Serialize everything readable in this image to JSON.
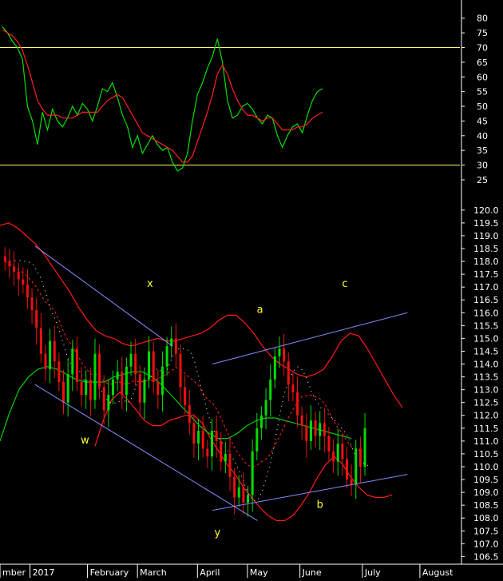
{
  "colors": {
    "background": "#000000",
    "axis": "#ffffff",
    "axis_text": "#ffffff",
    "oscillator": "#00e000",
    "signal": "#ff2020",
    "reference_line": "#ffff66",
    "candle_up": "#00dd00",
    "candle_down": "#ee1111",
    "band": "#ff1a1a",
    "midline": "#00cc00",
    "dashed_ma": "#ff2020",
    "dotted_ma": "#ffffff",
    "channel": "#8b8bff",
    "labels": "#ffff33"
  },
  "chart_data": [
    {
      "type": "line",
      "panel": "oscillator",
      "ylim": [
        22,
        84
      ],
      "y_ticks": [
        "25",
        "30",
        "35",
        "40",
        "45",
        "50",
        "55",
        "60",
        "65",
        "70",
        "75",
        "80"
      ],
      "reference_lines": [
        30,
        70
      ],
      "x": [
        1,
        3,
        5,
        7,
        9,
        11,
        13,
        15,
        17,
        19,
        21,
        23,
        25,
        27,
        29,
        31,
        33,
        35,
        37,
        39,
        41,
        43,
        45,
        47,
        49,
        51,
        53,
        55,
        57,
        59,
        61,
        63,
        65,
        67,
        69,
        71,
        73,
        75,
        77,
        79,
        81,
        83,
        85,
        87,
        89,
        91,
        93,
        95,
        97,
        99,
        101,
        103,
        105,
        107,
        109,
        111,
        113,
        115,
        117,
        119,
        121,
        123,
        125,
        127,
        129
      ],
      "series": [
        {
          "values": [
            77,
            75,
            72,
            70,
            66,
            50,
            45,
            37,
            48,
            42,
            49,
            45,
            43,
            46,
            50,
            47,
            51,
            49,
            45,
            50,
            56,
            55,
            58,
            53,
            47,
            43,
            36,
            40,
            34,
            37,
            40,
            37,
            35,
            36,
            31,
            28,
            29,
            34,
            45,
            54,
            58,
            63,
            67,
            73,
            65,
            52,
            46,
            47,
            50,
            51,
            49,
            46,
            44,
            47,
            46,
            40,
            36,
            40,
            43,
            44,
            41,
            47,
            52,
            55,
            56
          ]
        },
        {
          "values": [
            76,
            75,
            74,
            72,
            69,
            64,
            58,
            52,
            49,
            47,
            47,
            47,
            46,
            46,
            46,
            47,
            48,
            48,
            48,
            48,
            50,
            52,
            53,
            54,
            53,
            50,
            47,
            44,
            41,
            40,
            39,
            38,
            37,
            36,
            35,
            33,
            31,
            31,
            33,
            38,
            43,
            48,
            54,
            61,
            64,
            61,
            56,
            52,
            49,
            47,
            47,
            46,
            45,
            46,
            46,
            44,
            42,
            42,
            42,
            43,
            43,
            44,
            46,
            47,
            48
          ]
        }
      ]
    },
    {
      "type": "candlestick",
      "panel": "price",
      "ylim": [
        106.2,
        120.4
      ],
      "y_ticks": [
        "106.5",
        "107.0",
        "107.5",
        "108.0",
        "108.5",
        "109.0",
        "109.5",
        "110.0",
        "110.5",
        "111.0",
        "111.5",
        "112.0",
        "112.5",
        "113.0",
        "113.5",
        "114.0",
        "114.5",
        "115.0",
        "115.5",
        "116.0",
        "116.5",
        "117.0",
        "117.5",
        "118.0",
        "118.5",
        "119.0",
        "119.5",
        "120.0"
      ],
      "x_labels": [
        "mber",
        "2017",
        "February",
        "March",
        "April",
        "May",
        "June",
        "July",
        "August"
      ],
      "x_label_positions": [
        0,
        12,
        35,
        55,
        79,
        99,
        120,
        145,
        168
      ],
      "x_range": [
        0,
        184
      ],
      "close": [
        118.0,
        117.8,
        117.6,
        117.3,
        117.1,
        116.6,
        116.1,
        115.4,
        114.4,
        113.8,
        114.9,
        114.1,
        113.3,
        112.5,
        113.6,
        114.6,
        113.3,
        112.8,
        113.4,
        112.6,
        114.4,
        113.1,
        112.2,
        112.8,
        113.4,
        113.7,
        112.8,
        113.9,
        114.4,
        113.6,
        112.5,
        113.4,
        114.5,
        113.3,
        112.8,
        113.9,
        114.7,
        115.0,
        114.4,
        113.1,
        112.4,
        111.7,
        110.9,
        111.4,
        110.7,
        110.4,
        111.4,
        111.0,
        110.2,
        110.5,
        109.6,
        108.8,
        109.2,
        108.6,
        108.9,
        110.6,
        111.5,
        112.0,
        112.6,
        113.4,
        114.3,
        114.6,
        114.1,
        113.2,
        112.9,
        112.0,
        111.6,
        111.0,
        111.8,
        111.2,
        111.7,
        111.2,
        110.6,
        110.2,
        110.9,
        110.3,
        109.5,
        109.3,
        110.7,
        110.0,
        111.5
      ],
      "bands": {
        "upper": [
          119.4,
          119.5,
          119.3,
          119.0,
          118.7,
          118.3,
          117.8,
          117.3,
          116.8,
          116.2,
          115.7,
          115.3,
          115.1,
          115.0,
          114.8,
          114.7,
          114.8,
          114.9,
          115.0,
          114.9,
          114.9,
          115.0,
          115.1,
          115.2,
          115.4,
          115.7,
          115.9,
          115.9,
          115.6,
          115.2,
          114.7,
          114.3,
          114.0,
          113.8,
          113.6,
          113.5,
          113.6,
          113.8,
          114.3,
          114.9,
          115.2,
          115.1,
          114.6,
          114.0,
          113.4,
          112.8,
          112.3
        ],
        "middle": [
          111.0,
          112.1,
          113.0,
          113.5,
          113.8,
          113.9,
          113.8,
          113.6,
          113.4,
          113.3,
          113.3,
          113.3,
          113.5,
          113.6,
          113.7,
          113.7,
          113.5,
          113.2,
          112.8,
          112.4,
          112.0,
          111.6,
          111.3,
          111.1,
          111.1,
          111.3,
          111.6,
          111.8,
          111.9,
          111.9,
          111.8,
          111.7,
          111.6,
          111.5,
          111.4,
          111.3,
          111.2,
          111.1
        ],
        "lower": [
          110.8,
          111.8,
          112.6,
          112.9,
          112.6,
          112.2,
          111.8,
          111.6,
          111.6,
          111.8,
          111.9,
          112.0,
          112.0,
          111.7,
          111.1,
          110.6,
          110.1,
          109.7,
          109.2,
          108.8,
          108.4,
          108.1,
          107.9,
          107.9,
          108.1,
          108.5,
          109.0,
          109.6,
          110.1,
          110.4,
          110.1,
          109.6,
          109.2,
          108.9,
          108.8,
          108.8,
          108.9
        ]
      },
      "channels": [
        {
          "from": [
            14,
            118.6
          ],
          "to": [
            69,
            114.7
          ],
          "color": "upper"
        },
        {
          "from": [
            14,
            113.2
          ],
          "to": [
            103,
            107.9
          ],
          "color": "lower"
        },
        {
          "from": [
            85,
            114.0
          ],
          "to": [
            163,
            116.0
          ],
          "color": "upper"
        },
        {
          "from": [
            85,
            108.3
          ],
          "to": [
            163,
            109.7
          ],
          "color": "lower"
        }
      ],
      "annotations": [
        {
          "text": "x",
          "at": [
            60,
            117.0
          ]
        },
        {
          "text": "w",
          "at": [
            34,
            110.9
          ]
        },
        {
          "text": "a",
          "at": [
            104,
            116.0
          ]
        },
        {
          "text": "c",
          "at": [
            138,
            117.0
          ]
        },
        {
          "text": "y",
          "at": [
            87,
            107.3
          ]
        },
        {
          "text": "b",
          "at": [
            128,
            108.4
          ]
        }
      ]
    }
  ]
}
